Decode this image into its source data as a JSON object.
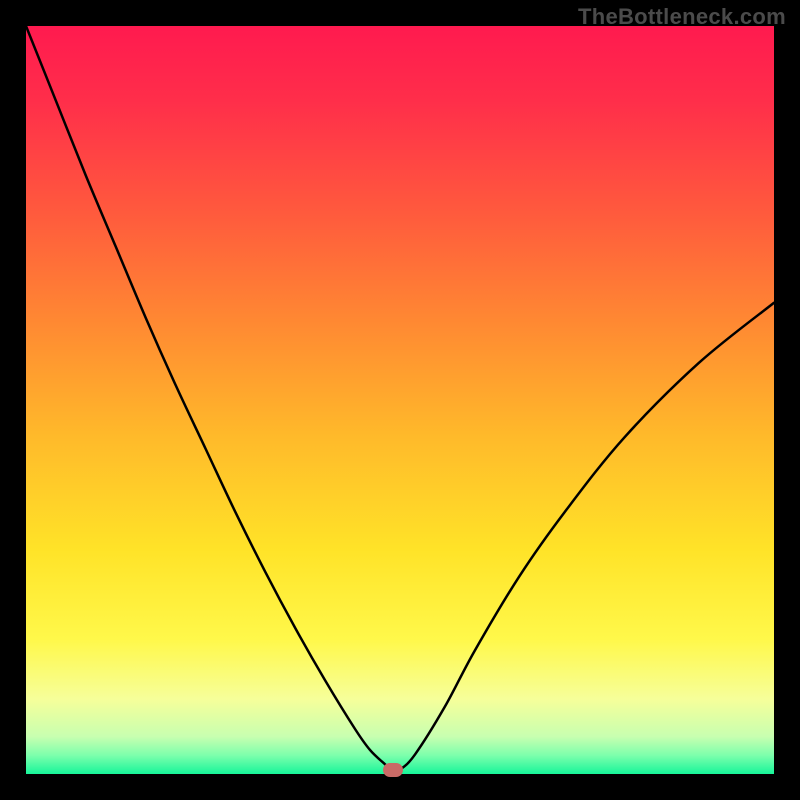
{
  "watermark": "TheBottleneck.com",
  "colors": {
    "frame_bg": "#000000",
    "curve": "#000000",
    "marker": "#c96a66",
    "gradient_stops": [
      {
        "offset": 0.0,
        "color": "#ff1a4f"
      },
      {
        "offset": 0.1,
        "color": "#ff2e4a"
      },
      {
        "offset": 0.25,
        "color": "#ff5a3d"
      },
      {
        "offset": 0.4,
        "color": "#ff8a32"
      },
      {
        "offset": 0.55,
        "color": "#ffba2a"
      },
      {
        "offset": 0.7,
        "color": "#ffe328"
      },
      {
        "offset": 0.82,
        "color": "#fff84a"
      },
      {
        "offset": 0.9,
        "color": "#f6ff9a"
      },
      {
        "offset": 0.95,
        "color": "#c8ffb0"
      },
      {
        "offset": 0.975,
        "color": "#7dffac"
      },
      {
        "offset": 1.0,
        "color": "#17f59a"
      }
    ]
  },
  "chart_data": {
    "type": "line",
    "title": "",
    "xlabel": "",
    "ylabel": "",
    "xlim": [
      0,
      100
    ],
    "ylim": [
      0,
      100
    ],
    "grid": false,
    "legend": false,
    "x": [
      0,
      4,
      8,
      12,
      16,
      20,
      24,
      28,
      32,
      36,
      40,
      44,
      46,
      48,
      49,
      50,
      52,
      56,
      60,
      66,
      72,
      80,
      90,
      100
    ],
    "values": [
      100,
      90,
      80,
      70.5,
      61,
      52,
      43.5,
      35,
      27,
      19.5,
      12.5,
      6,
      3.2,
      1.3,
      0.5,
      0.6,
      2.6,
      9,
      16.5,
      26.5,
      35,
      45,
      55,
      63
    ],
    "marker": {
      "x": 49,
      "y": 0.5
    },
    "curve_stroke_width": 2.5
  }
}
